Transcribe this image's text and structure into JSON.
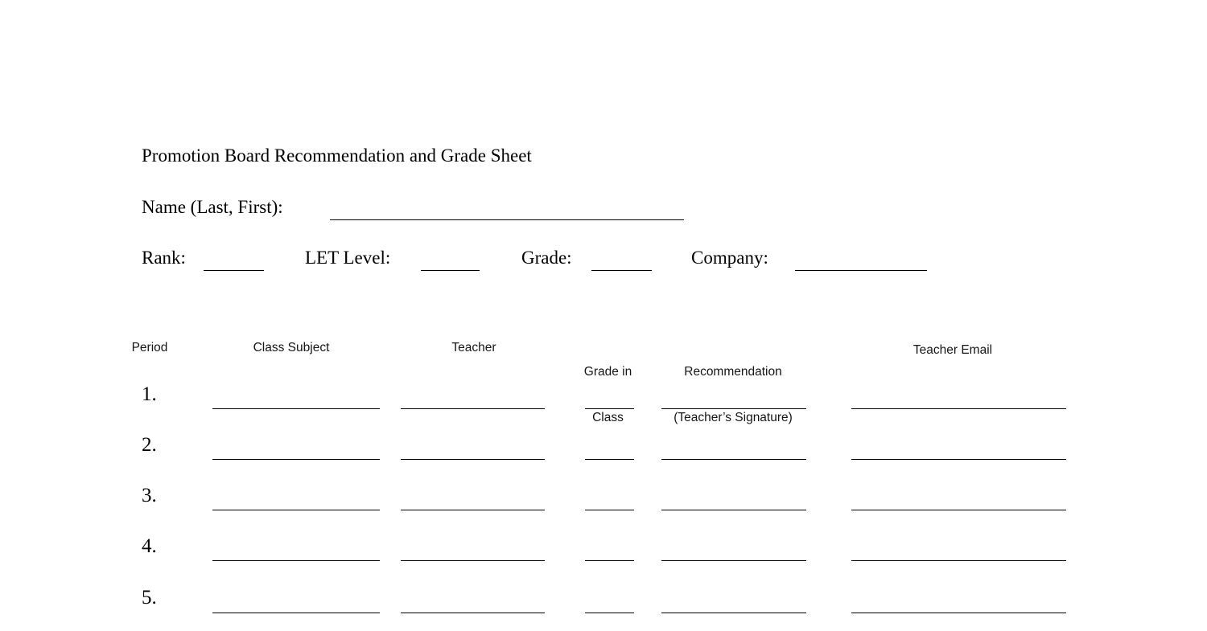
{
  "document": {
    "title": "Promotion Board Recommendation and Grade Sheet",
    "background_color": "#ffffff",
    "text_color": "#000000"
  },
  "identity_fields": {
    "name_label": "Name (Last, First):",
    "rank_label": "Rank:",
    "let_level_label": "LET Level:",
    "grade_label": "Grade:",
    "company_label": "Company:",
    "name_value": "",
    "rank_value": "",
    "let_level_value": "",
    "grade_value": "",
    "company_value": ""
  },
  "table": {
    "headers": {
      "period": "Period",
      "class_subject": "Class Subject",
      "teacher": "Teacher",
      "grade_in_class_line1": "Grade in",
      "grade_in_class_line2": "Class",
      "recommendation_line1": "Recommendation",
      "recommendation_line2": "(Teacher’s Signature)",
      "teacher_email": "Teacher Email"
    },
    "rows": [
      {
        "period": "1.",
        "class_subject": "",
        "teacher": "",
        "grade_in_class": "",
        "recommendation": "",
        "teacher_email": ""
      },
      {
        "period": "2.",
        "class_subject": "",
        "teacher": "",
        "grade_in_class": "",
        "recommendation": "",
        "teacher_email": ""
      },
      {
        "period": "3.",
        "class_subject": "",
        "teacher": "",
        "grade_in_class": "",
        "recommendation": "",
        "teacher_email": ""
      },
      {
        "period": "4.",
        "class_subject": "",
        "teacher": "",
        "grade_in_class": "",
        "recommendation": "",
        "teacher_email": ""
      },
      {
        "period": "5.",
        "class_subject": "",
        "teacher": "",
        "grade_in_class": "",
        "recommendation": "",
        "teacher_email": ""
      }
    ]
  }
}
